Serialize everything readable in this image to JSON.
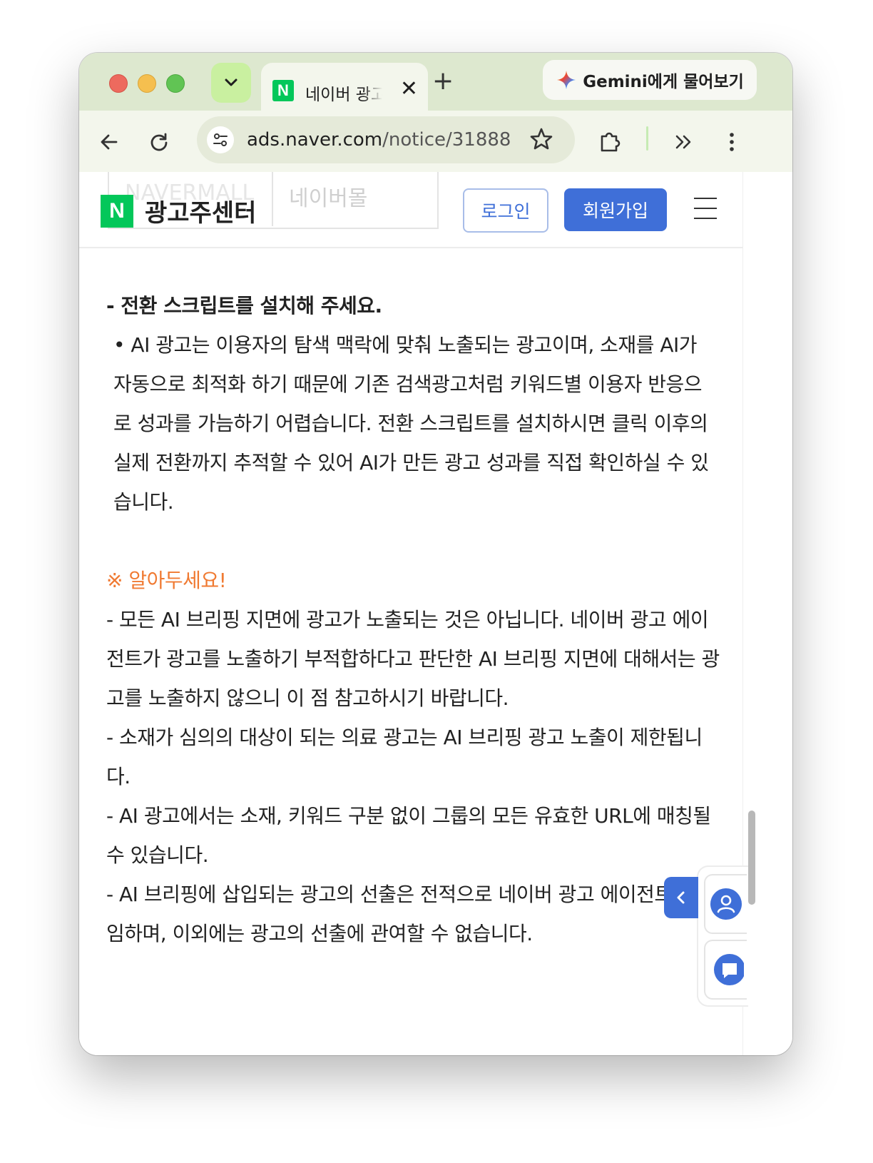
{
  "browser": {
    "tab": {
      "title": "네이버 광고",
      "favicon_letter": "N"
    },
    "new_tab_label": "+",
    "gemini_label": "Gemini에게 물어보기",
    "url": {
      "host": "ads.naver.com",
      "path": "/notice/31888"
    }
  },
  "site": {
    "ghost_left": "NAVERMALL",
    "ghost_right": "네이버몰",
    "logo_letter": "N",
    "logo_text": "광고주센터",
    "login_label": "로그인",
    "join_label": "회원가입"
  },
  "content": {
    "heading": "- 전환 스크립트를 설치해 주세요.",
    "bullet": "• AI 광고는 이용자의 탐색 맥락에 맞춰 노출되는 광고이며, 소재를 AI가 자동으로 최적화 하기 때문에 기존 검색광고처럼 키워드별 이용자 반응으로 성과를 가늠하기 어렵습니다. 전환 스크립트를 설치하시면 클릭 이후의 실제 전환까지 추적할 수 있어 AI가 만든 광고 성과를 직접 확인하실 수 있습니다.",
    "notice_title": "※ 알아두세요!",
    "notes": [
      "- 모든 AI 브리핑 지면에 광고가 노출되는 것은 아닙니다. 네이버 광고 에이전트가 광고를 노출하기 부적합하다고 판단한 AI 브리핑 지면에 대해서는 광고를 노출하지 않으니 이 점 참고하시기 바랍니다.",
      "- 소재가 심의의 대상이 되는 의료 광고는 AI 브리핑 광고 노출이 제한됩니다.",
      "- AI 광고에서는 소재, 키워드 구분 없이 그룹의 모든 유효한 URL에 매칭될 수 있습니다.",
      "- AI 브리핑에 삽입되는 광고의 선출은 전적으로 네이버 광고 에이전트가 일임하며, 이외에는 광고의 선출에 관여할 수 없습니다."
    ]
  },
  "colors": {
    "naver_green": "#03c75a",
    "accent_blue": "#3f6fd8",
    "notice_orange": "#f07a32"
  }
}
